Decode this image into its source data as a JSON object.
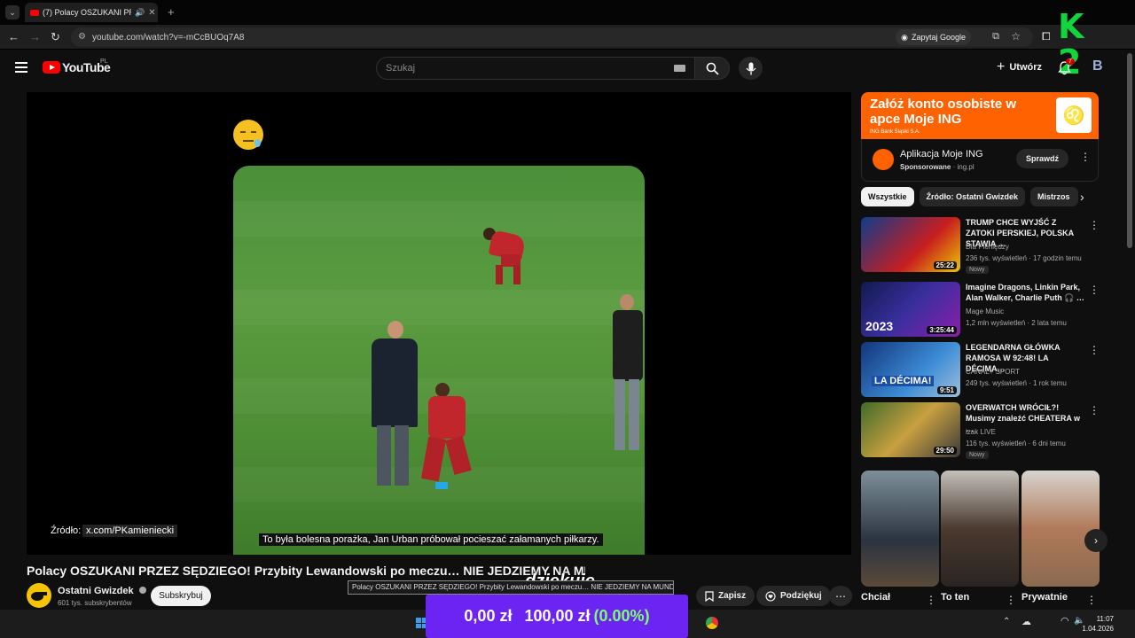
{
  "browser": {
    "tab_title": "(7) Polacy OSZUKANI PRZEZ",
    "url": "youtube.com/watch?v=-mCcBUOq7A8",
    "google_chip": "Zapytaj Google"
  },
  "header": {
    "logo_text": "YouTube",
    "logo_region": "PL",
    "search_placeholder": "Szukaj",
    "create_label": "Utwórz",
    "notifications_count": "7",
    "account_initial": "B"
  },
  "video": {
    "source_label": "Źródło:",
    "source_url": "x.com/PKamieniecki",
    "subtitle": "To była bolesna porażka, Jan Urban próbował pocieszać załamanych piłkarzy.",
    "title": "Polacy OSZUKANI PRZEZ SĘDZIEGO! Przybity Lewandowski po meczu… NIE JEDZIEMY NA MUNDIAL…",
    "overlay_text": "dziękuje",
    "tooltip": "Polacy OSZUKANI PRZEZ SĘDZIEGO! Przybity Lewandowski po meczu… NIE JEDZIEMY NA MUNDIAL…"
  },
  "channel": {
    "name": "Ostatni Gwizdek",
    "subscribers": "601 tys. subskrybentów",
    "subscribe_label": "Subskrybuj"
  },
  "actions": {
    "save_label": "Zapisz",
    "thanks_label": "Podziękuj"
  },
  "ad": {
    "headline": "Załóż konto osobiste w apce Moje ING",
    "bank": "ING Bank Śląski S.A.",
    "app_name": "Aplikacja Moje ING",
    "sponsored": "Sponsorowane",
    "domain": "· ing.pl",
    "cta": "Sprawdź"
  },
  "filter_chips": [
    "Wszystkie",
    "Źródło: Ostatni Gwizdek",
    "Mistrzos"
  ],
  "recommendations": [
    {
      "title": "TRUMP CHCE WYJŚĆ Z ZATOKI PERSKIEJ, POLSKA STAWIA …",
      "channel": "Dla Pieniędzy",
      "meta": "236 tys. wyświetleń · 17 godzin temu",
      "duration": "25:22",
      "badge": "Nowy",
      "thumb_color": "#b81e1e"
    },
    {
      "title": "Imagine Dragons, Linkin Park, Alan Walker, Charlie Puth 🎧 …",
      "channel": "Mage Music",
      "meta": "1,2 mln wyświetleń · 2 lata temu",
      "duration": "3:25:44",
      "badge": "",
      "thumb_color": "#2a2f8f"
    },
    {
      "title": "LEGENDARNA GŁÓWKA RAMOSA W 92:48! LA DÉCIMA…",
      "channel": "CANAL+ SPORT",
      "meta": "249 tys. wyświetleń · 1 rok temu",
      "duration": "9:51",
      "badge": "",
      "thumb_color": "#1c4f9c"
    },
    {
      "title": "OVERWATCH WRÓCIŁ?! Musimy znaleźć CHEATERA w …",
      "channel": "izak LIVE",
      "meta": "116 tys. wyświetleń · 6 dni temu",
      "duration": "29:50",
      "badge": "Nowy",
      "thumb_color": "#3f6b2a"
    }
  ],
  "shorts": [
    {
      "title": "Chciał",
      "color": "#6a7d8a"
    },
    {
      "title": "To ten",
      "color": "#8a7560"
    },
    {
      "title": "Prywatnie",
      "color": "#9a8c7a"
    }
  ],
  "stream_overlay": {
    "amount_a": "0,00 zł",
    "amount_b": "100,00 zł",
    "percent": "(0.00%)"
  },
  "clock": {
    "time": "11:07",
    "date": "1.04.2026"
  },
  "watermark": "K 2"
}
